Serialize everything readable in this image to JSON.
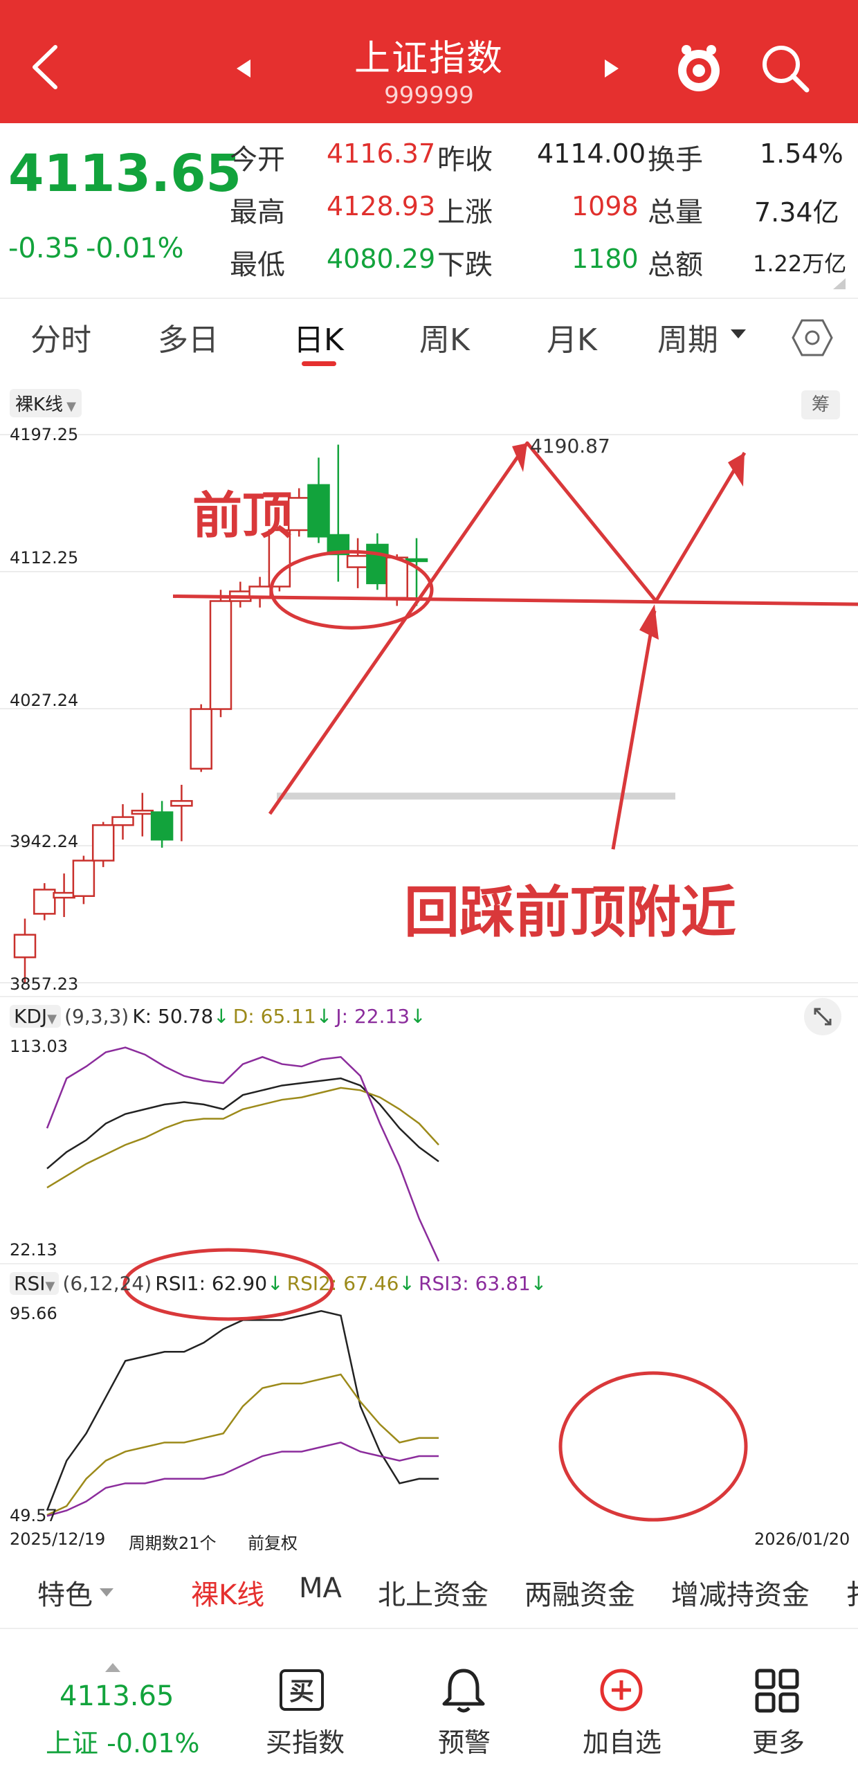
{
  "header": {
    "title": "上证指数",
    "code": "999999"
  },
  "quote": {
    "price": "4113.65",
    "change": "-0.35",
    "change_pct": "-0.01%",
    "rows": [
      [
        {
          "label": "今开",
          "value": "4116.37",
          "color": "red"
        },
        {
          "label": "昨收",
          "value": "4114.00",
          "color": "dark"
        },
        {
          "label": "换手",
          "value": "1.54%",
          "color": "dark"
        }
      ],
      [
        {
          "label": "最高",
          "value": "4128.93",
          "color": "red"
        },
        {
          "label": "上涨",
          "value": "1098",
          "color": "red"
        },
        {
          "label": "总量",
          "value": "7.34亿",
          "color": "dark"
        }
      ],
      [
        {
          "label": "最低",
          "value": "4080.29",
          "color": "green"
        },
        {
          "label": "下跌",
          "value": "1180",
          "color": "green"
        },
        {
          "label": "总额",
          "value": "1.22万亿",
          "color": "dark"
        }
      ]
    ]
  },
  "tabs": [
    "分时",
    "多日",
    "日K",
    "周K",
    "月K",
    "周期"
  ],
  "active_tab": 2,
  "main_chart": {
    "label": "裸K线",
    "right_chip": "筹",
    "y_labels": [
      "4197.25",
      "4112.25",
      "4027.24",
      "3942.24",
      "3857.23"
    ],
    "high_label": "4190.87",
    "annotation_top": "前顶",
    "annotation_bottom": "回踩前顶附近"
  },
  "kdj": {
    "name": "KDJ",
    "params": "(9,3,3)",
    "k": "K: 50.78",
    "d": "D: 65.11",
    "j": "J: 22.13",
    "y_max": "113.03",
    "y_min": "22.13"
  },
  "rsi": {
    "name": "RSI",
    "params": "(6,12,24)",
    "r1": "RSI1: 62.90",
    "r2": "RSI2: 67.46",
    "r3": "RSI3: 63.81",
    "y_max": "95.66",
    "y_min": "49.57"
  },
  "footer_axis": {
    "start": "2025/12/19",
    "period": "周期数21个",
    "adjust": "前复权",
    "end": "2026/01/20"
  },
  "bottom_tabs": [
    "特色",
    "裸K线",
    "MA",
    "北上资金",
    "两融资金",
    "增减持资金",
    "扌"
  ],
  "nav": {
    "price": "4113.65",
    "index_label": "上证 -0.01%",
    "items": [
      "买指数",
      "预警",
      "加自选",
      "更多"
    ]
  },
  "colors": {
    "header": "#e5302f",
    "up": "#c9302c",
    "down": "#12a33c",
    "k_line": "#222222",
    "d_line": "#9c8a1a",
    "j_line": "#8b2c9c"
  },
  "chart_data": [
    {
      "type": "candlestick",
      "title": "",
      "ylim": [
        3857.23,
        4197.25
      ],
      "y_ticks": [
        4197.25,
        4112.25,
        4027.24,
        3942.24,
        3857.23
      ],
      "x_start": "2025/12/19",
      "x_end": "2026/01/20",
      "candles": [
        {
          "o": 3873,
          "c": 3887,
          "h": 3897,
          "l": 3857
        },
        {
          "o": 3900,
          "c": 3915,
          "h": 3919,
          "l": 3896
        },
        {
          "o": 3910,
          "c": 3913,
          "h": 3925,
          "l": 3898
        },
        {
          "o": 3911,
          "c": 3933,
          "h": 3936,
          "l": 3906
        },
        {
          "o": 3933,
          "c": 3955,
          "h": 3957,
          "l": 3929
        },
        {
          "o": 3955,
          "c": 3960,
          "h": 3968,
          "l": 3946
        },
        {
          "o": 3962,
          "c": 3964,
          "h": 3975,
          "l": 3948
        },
        {
          "o": 3963,
          "c": 3946,
          "h": 3970,
          "l": 3941
        },
        {
          "o": 3967,
          "c": 3970,
          "h": 3980,
          "l": 3945
        },
        {
          "o": 3990,
          "c": 4027,
          "h": 4030,
          "l": 3988
        },
        {
          "o": 4027,
          "c": 4094,
          "h": 4101,
          "l": 4022
        },
        {
          "o": 4094,
          "c": 4100,
          "h": 4106,
          "l": 4090
        },
        {
          "o": 4096,
          "c": 4103,
          "h": 4109,
          "l": 4090
        },
        {
          "o": 4103,
          "c": 4138,
          "h": 4140,
          "l": 4100
        },
        {
          "o": 4138,
          "c": 4158,
          "h": 4164,
          "l": 4134
        },
        {
          "o": 4166,
          "c": 4134,
          "h": 4183,
          "l": 4130
        },
        {
          "o": 4135,
          "c": 4123,
          "h": 4191,
          "l": 4106
        },
        {
          "o": 4115,
          "c": 4122,
          "h": 4133,
          "l": 4102
        },
        {
          "o": 4129,
          "c": 4105,
          "h": 4136,
          "l": 4101
        },
        {
          "o": 4096,
          "c": 4121,
          "h": 4123,
          "l": 4091
        },
        {
          "o": 4120,
          "c": 4119,
          "h": 4133,
          "l": 4091
        }
      ]
    },
    {
      "type": "line",
      "title": "KDJ",
      "ylim": [
        22.13,
        113.03
      ],
      "series": [
        {
          "name": "K",
          "values": [
            61,
            68,
            73,
            80,
            84,
            86,
            88,
            89,
            88,
            86,
            92,
            94,
            96,
            97,
            98,
            99,
            96,
            88,
            78,
            70,
            64
          ]
        },
        {
          "name": "D",
          "values": [
            53,
            58,
            63,
            67,
            71,
            74,
            78,
            81,
            82,
            82,
            86,
            88,
            90,
            91,
            93,
            95,
            94,
            91,
            86,
            80,
            71
          ]
        },
        {
          "name": "J",
          "values": [
            78,
            99,
            104,
            110,
            112,
            109,
            104,
            100,
            98,
            97,
            105,
            108,
            105,
            104,
            107,
            108,
            100,
            80,
            62,
            40,
            22
          ]
        }
      ]
    },
    {
      "type": "line",
      "title": "RSI",
      "ylim": [
        49.57,
        95.66
      ],
      "series": [
        {
          "name": "RSI1",
          "values": [
            51,
            62,
            68,
            76,
            84,
            85,
            86,
            86,
            88,
            91,
            93,
            93,
            93,
            94,
            95,
            94,
            74,
            64,
            57,
            58,
            58
          ]
        },
        {
          "name": "RSI2",
          "values": [
            50,
            52,
            58,
            62,
            64,
            65,
            66,
            66,
            67,
            68,
            74,
            78,
            79,
            79,
            80,
            81,
            75,
            70,
            66,
            67,
            67
          ]
        },
        {
          "name": "RSI3",
          "values": [
            49.8,
            51,
            53,
            56,
            57,
            57,
            58,
            58,
            58,
            59,
            61,
            63,
            64,
            64,
            65,
            66,
            64,
            63,
            62,
            63,
            63
          ]
        }
      ]
    }
  ]
}
